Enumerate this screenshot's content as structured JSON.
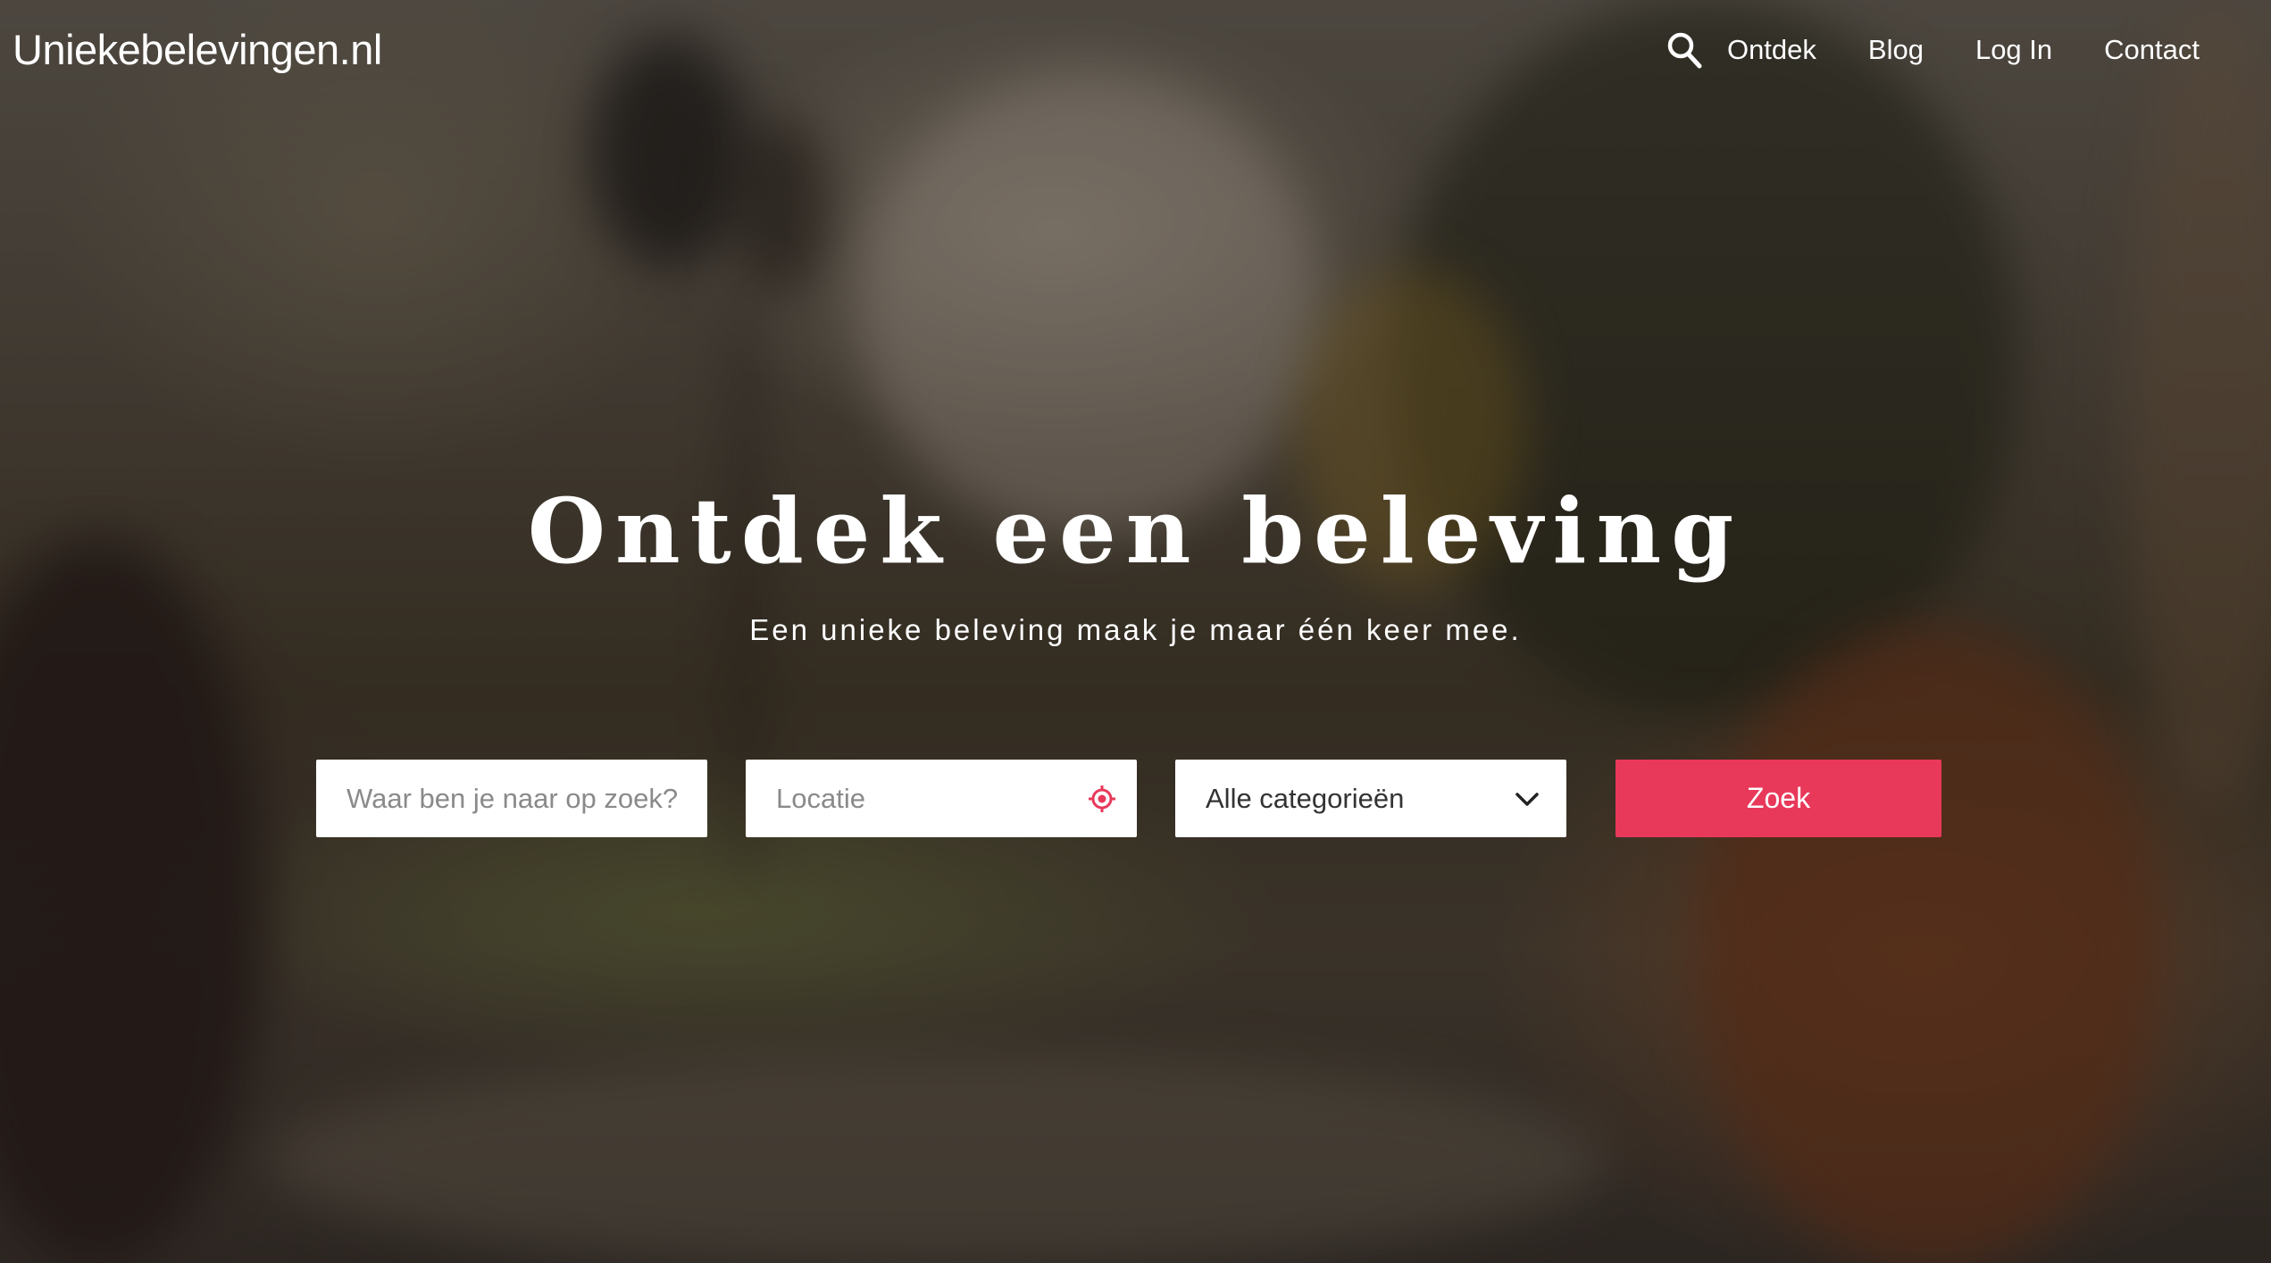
{
  "site": {
    "logo": "Uniekebelevingen.nl"
  },
  "nav": {
    "search_icon": "search-icon",
    "items": [
      {
        "label": "Ontdek"
      },
      {
        "label": "Blog"
      },
      {
        "label": "Log In"
      },
      {
        "label": "Contact"
      }
    ]
  },
  "hero": {
    "title": "Ontdek een beleving",
    "subtitle": "Een unieke beleving maak je maar één keer mee."
  },
  "search": {
    "what_placeholder": "Waar ben je naar op zoek?",
    "what_value": "",
    "location_placeholder": "Locatie",
    "location_value": "",
    "location_icon": "location-target-icon",
    "category_selected": "Alle categorieën",
    "category_icon": "chevron-down-icon",
    "submit_label": "Zoek"
  },
  "colors": {
    "accent": "#e8395a",
    "text_on_dark": "#ffffff",
    "field_background": "#ffffff",
    "placeholder": "#8a8a8a"
  }
}
